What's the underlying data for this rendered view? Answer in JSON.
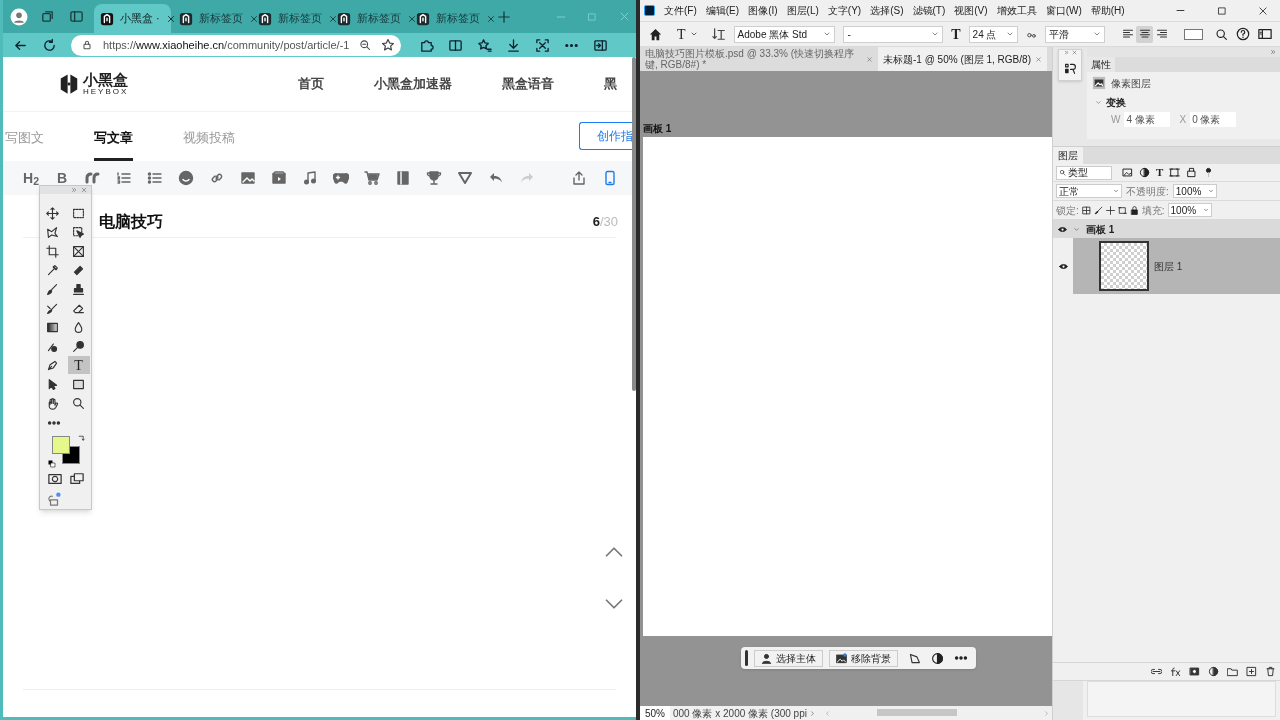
{
  "browser": {
    "tabs": [
      {
        "title": "小黑盒 ·",
        "selected": true
      },
      {
        "title": "新标签页",
        "selected": false
      },
      {
        "title": "新标签页",
        "selected": false
      },
      {
        "title": "新标签页",
        "selected": false
      },
      {
        "title": "新标签页",
        "selected": false
      }
    ],
    "url": "https://www.xiaoheihe.cn/community/post/article/-1"
  },
  "site": {
    "logo": "小黑盒",
    "logo_sub": "HEYBOX",
    "nav": [
      "首页",
      "小黑盒加速器",
      "黑盒语音",
      "黑"
    ],
    "post_tabs": [
      {
        "label": "写图文",
        "selected": false
      },
      {
        "label": "写文章",
        "selected": true
      },
      {
        "label": "视频投稿",
        "selected": false
      }
    ],
    "guide_button": "创作指",
    "heading_tool": "H$_{2}$",
    "bold_tool": "B",
    "title": "电脑技巧",
    "counter_current": "6",
    "counter_max": "/30"
  },
  "photoshop": {
    "menus": [
      "文件(F)",
      "编辑(E)",
      "图像(I)",
      "图层(L)",
      "文字(Y)",
      "选择(S)",
      "滤镜(T)",
      "视图(V)",
      "增效工具",
      "窗口(W)",
      "帮助(H)"
    ],
    "options": {
      "tool_glyph": "T",
      "font": "Adobe 黑体 Std",
      "style": "-",
      "size_glyph": "T",
      "size": "24 点",
      "antialias": "平滑",
      "align": [
        {
          "selected": false
        },
        {
          "selected": true
        },
        {
          "selected": false
        }
      ]
    },
    "documents": [
      {
        "title": "电脑技巧图片模板.psd @ 33.3% (快速切换程序键, RGB/8#) *",
        "selected": false
      },
      {
        "title": "未标题-1 @ 50% (图层 1, RGB/8)",
        "selected": true
      }
    ],
    "artboard_label": "画板 1",
    "taskbar": [
      "选择主体",
      "移除背景"
    ],
    "zoom": "50%",
    "doc_info": "000 像素 x 2000 像素 (300 ppi",
    "tools": [
      {
        "selected": false
      },
      {
        "selected": false
      },
      {
        "selected": false
      },
      {
        "selected": false
      },
      {
        "selected": false
      },
      {
        "selected": false
      },
      {
        "selected": false
      },
      {
        "selected": false
      },
      {
        "selected": false
      },
      {
        "selected": false
      },
      {
        "selected": false
      },
      {
        "selected": false
      },
      {
        "selected": false
      },
      {
        "selected": false
      },
      {
        "selected": false
      },
      {
        "selected": false
      },
      {
        "selected": false
      },
      {
        "selected": true,
        "glyph": "T"
      },
      {
        "selected": false
      },
      {
        "selected": false
      },
      {
        "selected": false
      },
      {
        "selected": false
      }
    ],
    "properties": {
      "title": "属性",
      "layer_type": "像素图层",
      "section": "变换",
      "w_label": "W",
      "w": "4 像素",
      "x_label": "X",
      "x": "0 像素"
    },
    "layers_panel": {
      "tab": "图层",
      "filter": "类型",
      "filter_glyph": "T",
      "blend": "正常",
      "opacity_label": "不透明度:",
      "opacity": "100%",
      "lock_label": "锁定:",
      "fill_label": "填充:",
      "fill": "100%",
      "layers": [
        {
          "name": "画板 1",
          "visible": true,
          "expanded": true,
          "selected": false,
          "children": [
            {
              "name": "图层 1",
              "visible": true,
              "selected": true
            }
          ]
        }
      ]
    }
  }
}
